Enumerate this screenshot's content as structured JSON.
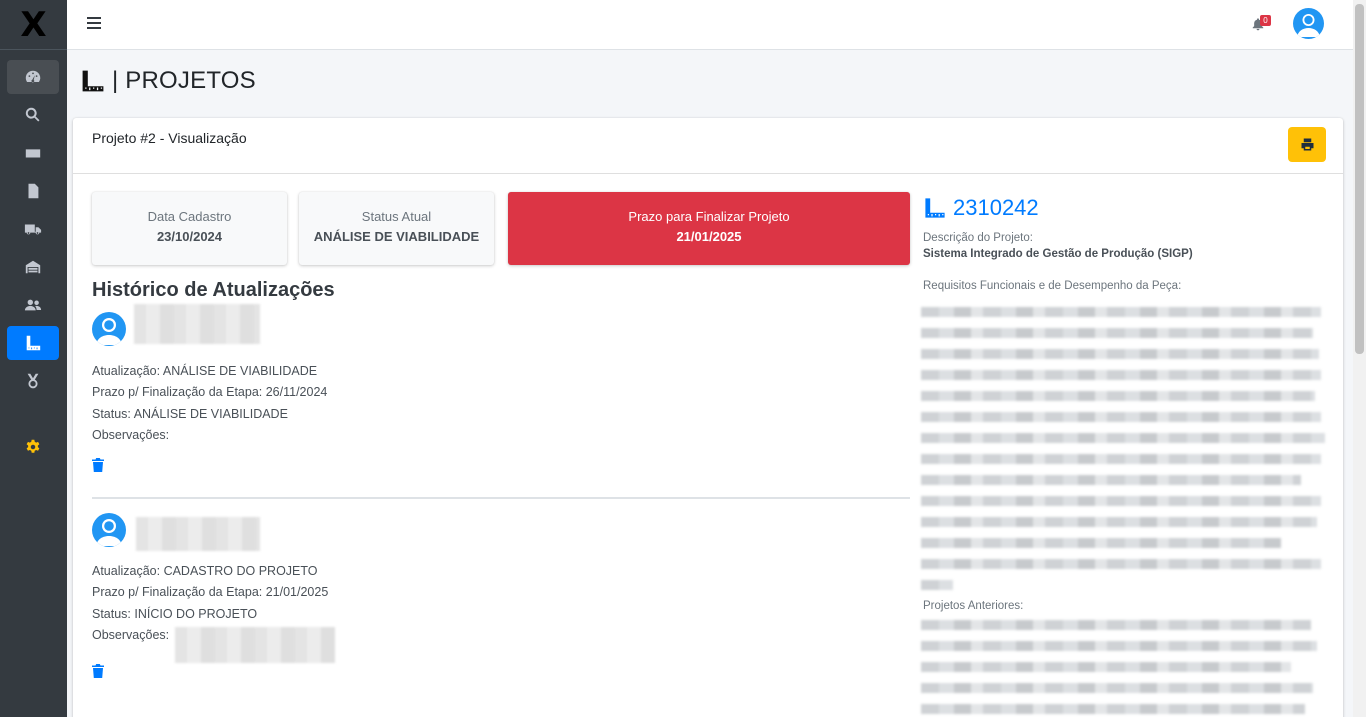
{
  "app": {
    "logo_text": "X"
  },
  "sidebar": {
    "items": [
      {
        "icon": "tachometer-icon",
        "name": "dashboard"
      },
      {
        "icon": "search-icon",
        "name": "search"
      },
      {
        "icon": "id-card-icon",
        "name": "cards"
      },
      {
        "icon": "file-icon",
        "name": "documents"
      },
      {
        "icon": "truck-icon",
        "name": "delivery"
      },
      {
        "icon": "warehouse-icon",
        "name": "storage"
      },
      {
        "icon": "users-icon",
        "name": "users"
      },
      {
        "icon": "ruler-icon",
        "name": "projetos"
      },
      {
        "icon": "award-icon",
        "name": "awards"
      },
      {
        "icon": "gear-icon",
        "name": "settings"
      }
    ]
  },
  "topbar": {
    "notification_count": "0"
  },
  "page": {
    "title": "| PROJETOS"
  },
  "card": {
    "title": "Projeto #2 - Visualização",
    "print_icon": "print-icon"
  },
  "info": {
    "data_cadastro_label": "Data Cadastro",
    "data_cadastro_value": "23/10/2024",
    "status_label": "Status Atual",
    "status_value": "ANÁLISE DE VIABILIDADE",
    "prazo_label": "Prazo para Finalizar Projeto",
    "prazo_value": "21/01/2025",
    "danger_color": "#dc3545"
  },
  "history": {
    "title": "Histórico de Atualizações",
    "entries": [
      {
        "atualizacao": "Atualização: ANÁLISE DE VIABILIDADE",
        "prazo": "Prazo p/ Finalização da Etapa: 26/11/2024",
        "status": "Status: ANÁLISE DE VIABILIDADE",
        "observacoes": "Observações:"
      },
      {
        "atualizacao": "Atualização: CADASTRO DO PROJETO",
        "prazo": "Prazo p/ Finalização da Etapa: 21/01/2025",
        "status": "Status: INÍCIO DO PROJETO",
        "observacoes": "Observações:"
      }
    ]
  },
  "project": {
    "code": "2310242",
    "descricao_label": "Descrição do Projeto:",
    "descricao_value": "Sistema Integrado de Gestão de Produção (SIGP)",
    "requisitos_label": "Requisitos Funcionais e de Desempenho da Peça:",
    "anteriores_label": "Projetos Anteriores:"
  }
}
